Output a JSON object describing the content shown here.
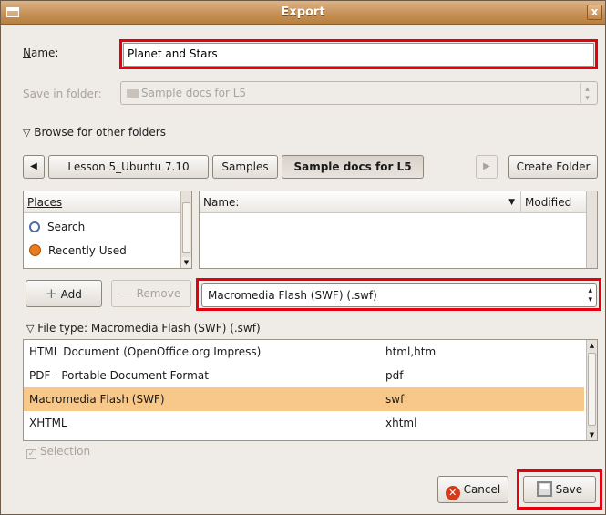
{
  "window": {
    "title": "Export",
    "close_label": "x"
  },
  "name_field": {
    "label": "Name:",
    "value": "Planet and Stars"
  },
  "save_in_folder": {
    "label": "Save in folder:",
    "value": "Sample docs for L5"
  },
  "browse_toggle": {
    "label": "Browse for other folders",
    "expanded": true
  },
  "path_bar": {
    "segments": [
      "Lesson 5_Ubuntu 7.10",
      "Samples",
      "Sample docs for L5"
    ],
    "active_segment": "Sample docs for L5",
    "create_folder_label": "Create Folder"
  },
  "places": {
    "header": "Places",
    "items": [
      {
        "icon": "search-icon",
        "label": "Search"
      },
      {
        "icon": "recently-used-icon",
        "label": "Recently Used"
      }
    ]
  },
  "files_panel": {
    "name_header": "Name:",
    "modified_header": "Modified"
  },
  "places_buttons": {
    "add_label": "Add",
    "remove_label": "Remove"
  },
  "filter_select": {
    "value": "Macromedia Flash (SWF) (.swf)"
  },
  "file_type": {
    "label": "File type: Macromedia Flash (SWF) (.swf)",
    "items": [
      {
        "name": "HTML Document (OpenOffice.org Impress)",
        "ext": "html,htm",
        "selected": false
      },
      {
        "name": "PDF - Portable Document Format",
        "ext": "pdf",
        "selected": false
      },
      {
        "name": "Macromedia Flash (SWF)",
        "ext": "swf",
        "selected": true
      },
      {
        "name": "XHTML",
        "ext": "xhtml",
        "selected": false
      }
    ]
  },
  "selection_checkbox": {
    "label": "Selection",
    "checked": true,
    "enabled": false
  },
  "buttons": {
    "cancel_label": "Cancel",
    "save_label": "Save"
  },
  "colors": {
    "highlight": "#e4000f",
    "selected_row": "#f8c88a",
    "titlebar": "#c79259"
  }
}
